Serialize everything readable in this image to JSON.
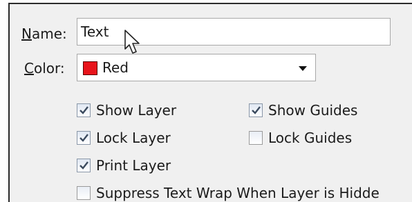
{
  "name_field": {
    "label_u": "N",
    "label_rest": "ame:",
    "value": "Text"
  },
  "color_field": {
    "label_u": "C",
    "label_rest": "olor:",
    "value": "Red",
    "swatch": "#e8141b"
  },
  "options": {
    "show_layer": {
      "label": "Show Layer",
      "checked": true
    },
    "show_guides": {
      "label": "Show Guides",
      "checked": true
    },
    "lock_layer": {
      "label": "Lock Layer",
      "checked": true
    },
    "lock_guides": {
      "label": "Lock Guides",
      "checked": false
    },
    "print_layer": {
      "label": "Print Layer",
      "checked": true
    },
    "suppress_text_wrap": {
      "label": "Suppress Text Wrap When Layer is Hidde",
      "checked": false
    }
  },
  "icons": {
    "cursor": "arrow-cursor-icon",
    "dropdown": "chevron-down-icon",
    "check": "checkmark-icon"
  }
}
